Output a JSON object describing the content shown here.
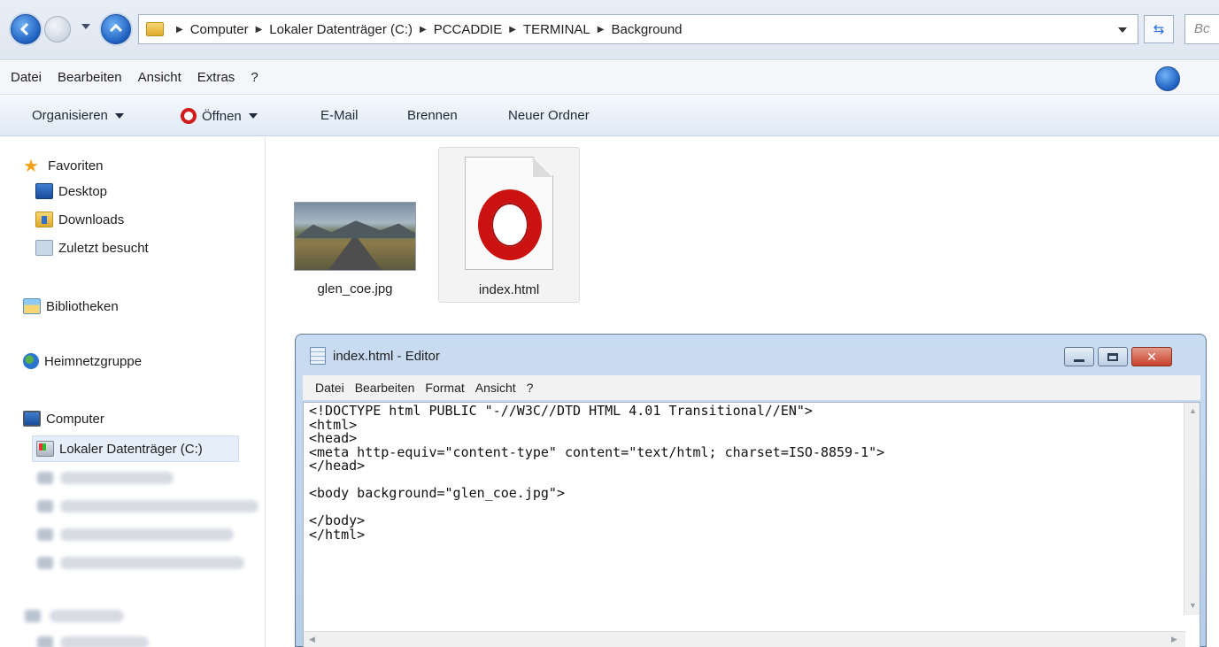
{
  "address": {
    "crumbs": [
      "Computer",
      "Lokaler Datenträger (C:)",
      "PCCADDIE",
      "TERMINAL",
      "Background"
    ],
    "search_placeholder": "Bc"
  },
  "menubar": {
    "items": [
      "Datei",
      "Bearbeiten",
      "Ansicht",
      "Extras",
      "?"
    ]
  },
  "commandbar": {
    "organize": "Organisieren",
    "open": "Öffnen",
    "email": "E-Mail",
    "burn": "Brennen",
    "new_folder": "Neuer Ordner"
  },
  "sidebar": {
    "favorites": "Favoriten",
    "desktop": "Desktop",
    "downloads": "Downloads",
    "recent": "Zuletzt besucht",
    "libraries": "Bibliotheken",
    "homegroup": "Heimnetzgruppe",
    "computer": "Computer",
    "local_disk": "Lokaler Datenträger (C:)"
  },
  "files": [
    {
      "name": "glen_coe.jpg",
      "icon": "photo-thumbnail"
    },
    {
      "name": "index.html",
      "icon": "opera-icon"
    }
  ],
  "editor": {
    "title": "index.html - Editor",
    "menu": [
      "Datei",
      "Bearbeiten",
      "Format",
      "Ansicht",
      "?"
    ],
    "code": "<!DOCTYPE html PUBLIC \"-//W3C//DTD HTML 4.01 Transitional//EN\">\n<html>\n<head>\n<meta http-equiv=\"content-type\" content=\"text/html; charset=ISO-8859-1\">\n</head>\n\n<body background=\"glen_coe.jpg\">\n\n</body>\n</html>"
  }
}
